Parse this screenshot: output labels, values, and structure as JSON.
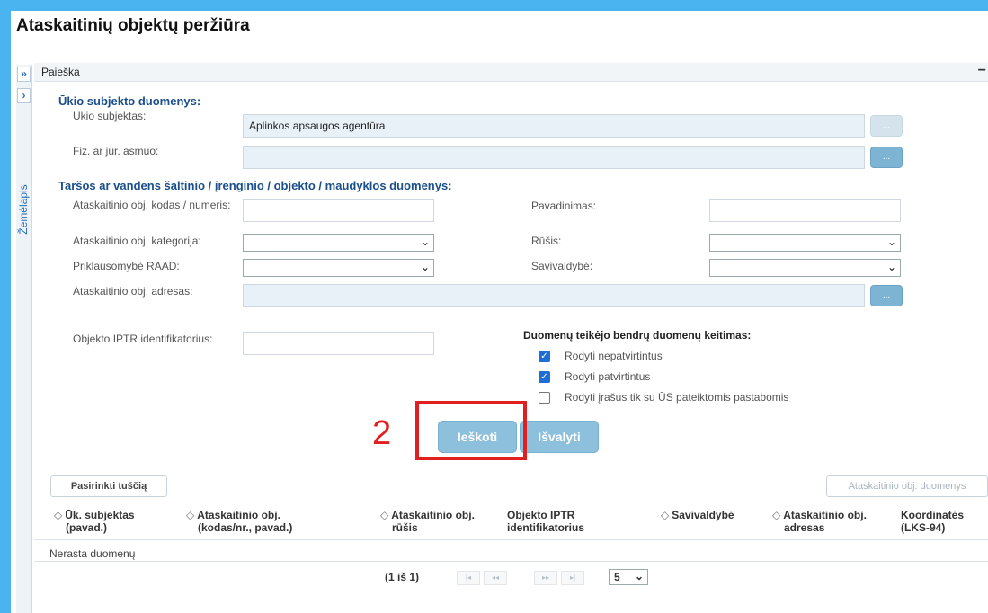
{
  "page": {
    "title": "Ataskaitinių objektų peržiūra"
  },
  "left_strip": {
    "expand_icon": "»",
    "next_icon": "›",
    "map_label": "Žemėlapis"
  },
  "search_panel": {
    "title": "Paieška",
    "collapse_icon": "−",
    "subject_section": {
      "heading": "Ūkio subjekto duomenys:",
      "subject_label": "Ūkio subjektas:",
      "subject_value": "Aplinkos apsaugos agentūra",
      "person_label": "Fiz. ar jur. asmuo:",
      "person_value": "",
      "dots": "..."
    },
    "source_section": {
      "heading": "Taršos ar vandens šaltinio / įrenginio / objekto / maudyklos duomenys:",
      "code_label": "Ataskaitinio obj. kodas / numeris:",
      "name_label": "Pavadinimas:",
      "category_label": "Ataskaitinio obj. kategorija:",
      "type_label": "Rūšis:",
      "raad_label": "Priklausomybė RAAD:",
      "municipality_label": "Savivaldybė:",
      "address_label": "Ataskaitinio obj. adresas:",
      "iptr_label": "Objekto IPTR identifikatorius:",
      "chevron": "⌄"
    },
    "provider_changes": {
      "heading": "Duomenų teikėjo bendrų duomenų keitimas:",
      "options": [
        {
          "label": "Rodyti nepatvirtintus",
          "checked": true
        },
        {
          "label": "Rodyti patvirtintus",
          "checked": true
        },
        {
          "label": "Rodyti įrašus tik su ŪS pateiktomis pastabomis",
          "checked": false
        }
      ],
      "check_mark": "✓"
    },
    "buttons": {
      "search": "Ieškoti",
      "clear": "Išvalyti"
    }
  },
  "annotation": {
    "number": "2",
    "color": "#e02020"
  },
  "results": {
    "choose_empty": "Pasirinkti tuščią",
    "object_data": "Ataskaitinio obj. duomenys",
    "sort_icon": "◇",
    "columns": [
      {
        "line1": "Ūk. subjektas",
        "line2": "(pavad.)",
        "sortable": true
      },
      {
        "line1": "Ataskaitinio obj.",
        "line2": "(kodas/nr., pavad.)",
        "sortable": true
      },
      {
        "line1": "Ataskaitinio obj.",
        "line2": "rūšis",
        "sortable": true
      },
      {
        "line1": "Objekto IPTR",
        "line2": "identifikatorius",
        "sortable": false
      },
      {
        "line1": "Savivaldybė",
        "line2": "",
        "sortable": true
      },
      {
        "line1": "Ataskaitinio obj.",
        "line2": "adresas",
        "sortable": true
      },
      {
        "line1": "Koordinatės",
        "line2": "(LKS-94)",
        "sortable": false
      }
    ],
    "no_data": "Nerasta duomenų",
    "pagination": {
      "summary": "(1 iš 1)",
      "first": "|◂",
      "prev": "◂◂",
      "next": "▸▸",
      "last": "▸|",
      "page_size": "5"
    }
  },
  "colors": {
    "background": "#4ab4f0",
    "accent_button": "#8cc0dc",
    "heading": "#1a4f8b",
    "checkbox": "#1f6ed4"
  }
}
